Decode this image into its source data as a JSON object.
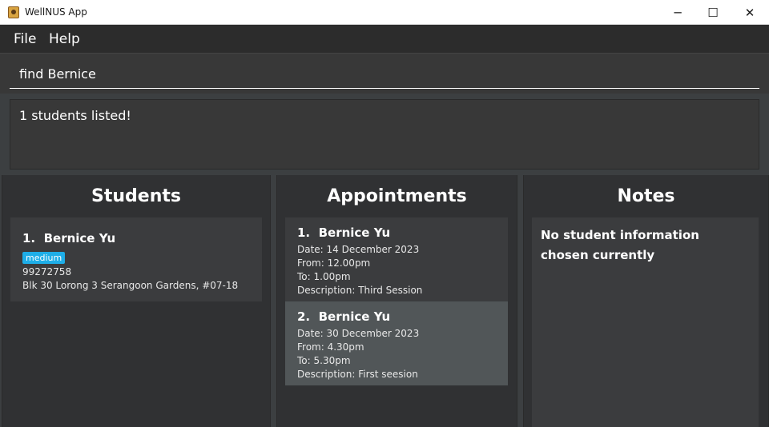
{
  "window": {
    "title": "WellNUS App",
    "minimize_glyph": "─",
    "maximize_glyph": "☐",
    "close_glyph": "✕"
  },
  "menu": {
    "file_label": "File",
    "help_label": "Help"
  },
  "command": {
    "value": "find Bernice"
  },
  "result": {
    "message": "1 students listed!"
  },
  "students_panel": {
    "title": "Students",
    "items": [
      {
        "index": "1.",
        "name": "Bernice Yu",
        "tag": "medium",
        "phone": "99272758",
        "address": "Blk 30 Lorong 3 Serangoon Gardens, #07-18"
      }
    ]
  },
  "appointments_panel": {
    "title": "Appointments",
    "items": [
      {
        "index": "1.",
        "name": "Bernice Yu",
        "date": "Date: 14 December 2023",
        "from": "From: 12.00pm",
        "to": "To: 1.00pm",
        "description": "Description: Third Session"
      },
      {
        "index": "2.",
        "name": "Bernice Yu",
        "date": "Date: 30 December 2023",
        "from": "From: 4.30pm",
        "to": "To: 5.30pm",
        "description": "Description: First seesion"
      }
    ]
  },
  "notes_panel": {
    "title": "Notes",
    "message": "No student information chosen currently"
  },
  "colors": {
    "tag_badge": "#1eaee8",
    "selected_card": "#515658",
    "panel_background": "#303133"
  }
}
